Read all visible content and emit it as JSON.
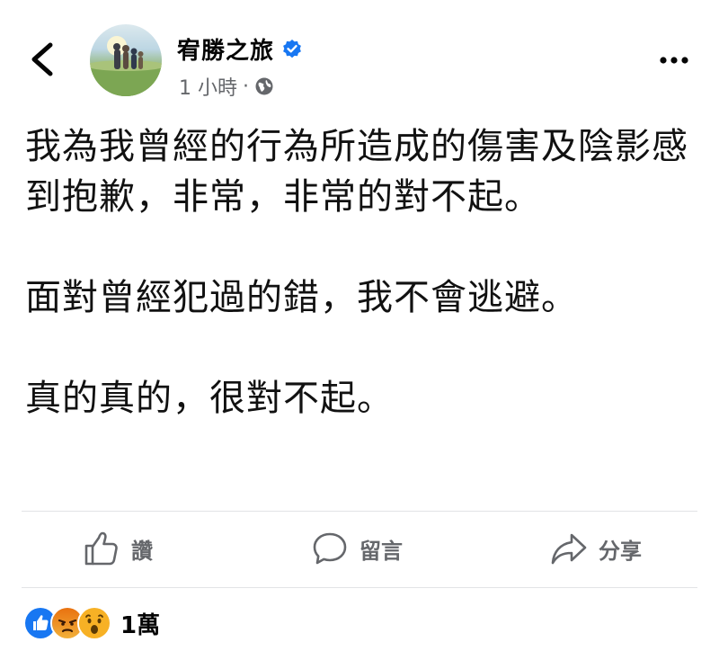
{
  "header": {
    "page_name": "宥勝之旅",
    "time": "1 小時",
    "separator": "·"
  },
  "post": {
    "paragraphs": [
      "我為我曾經的行為所造成的傷害及陰影感到抱歉，非常，非常的對不起。",
      "面對曾經犯過的錯，我不會逃避。",
      "真的真的，很對不起。"
    ]
  },
  "actions": {
    "like_label": "讚",
    "comment_label": "留言",
    "share_label": "分享"
  },
  "reactions": {
    "icons": [
      "like-icon",
      "angry-icon",
      "wow-icon"
    ],
    "count": "1萬"
  },
  "colors": {
    "brand_blue": "#1877f2",
    "secondary_text": "#65676b",
    "angry_orange": "#e9710f",
    "wow_yellow": "#f7b125"
  }
}
